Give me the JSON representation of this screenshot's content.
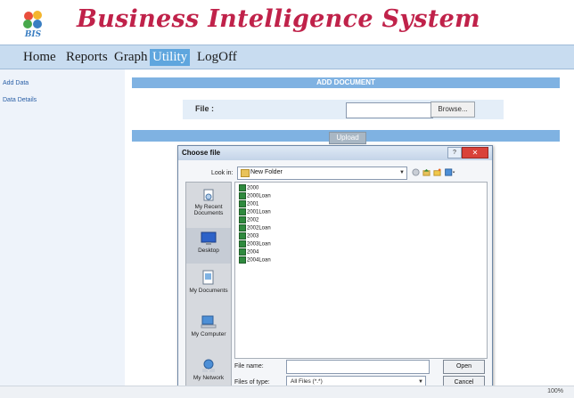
{
  "header": {
    "title": "Business Intelligence System",
    "logo_text": "BIS"
  },
  "nav": {
    "items": [
      "Home",
      "Reports",
      "Graph",
      "Utility",
      "LogOff"
    ],
    "active": "Utility"
  },
  "sidebar": {
    "items": [
      "Add Data",
      "Data Details"
    ]
  },
  "panel": {
    "heading": "ADD DOCUMENT",
    "file_label": "File :",
    "file_value": "",
    "browse_label": "Browse...",
    "upload_label": "Upload"
  },
  "dialog": {
    "title": "Choose file",
    "help_label": "?",
    "close_label": "✕",
    "look_in_label": "Look in:",
    "look_in_value": "New Folder",
    "places": [
      "My Recent Documents",
      "Desktop",
      "My Documents",
      "My Computer",
      "My Network"
    ],
    "files": [
      "2000",
      "2000Loan",
      "2001",
      "2001Loan",
      "2002",
      "2002Loan",
      "2003",
      "2003Loan",
      "2004",
      "2004Loan"
    ],
    "file_name_label": "File name:",
    "file_name_value": "",
    "files_of_type_label": "Files of type:",
    "files_of_type_value": "All Files (*.*)",
    "open_label": "Open",
    "cancel_label": "Cancel"
  },
  "statusbar": {
    "zoom": "100%"
  },
  "colors": {
    "title": "#c0224a",
    "nav_bg": "#c8dcf0",
    "nav_active": "#5fa6de",
    "panel_bar": "#7fb2e2",
    "close": "#d9423a"
  }
}
